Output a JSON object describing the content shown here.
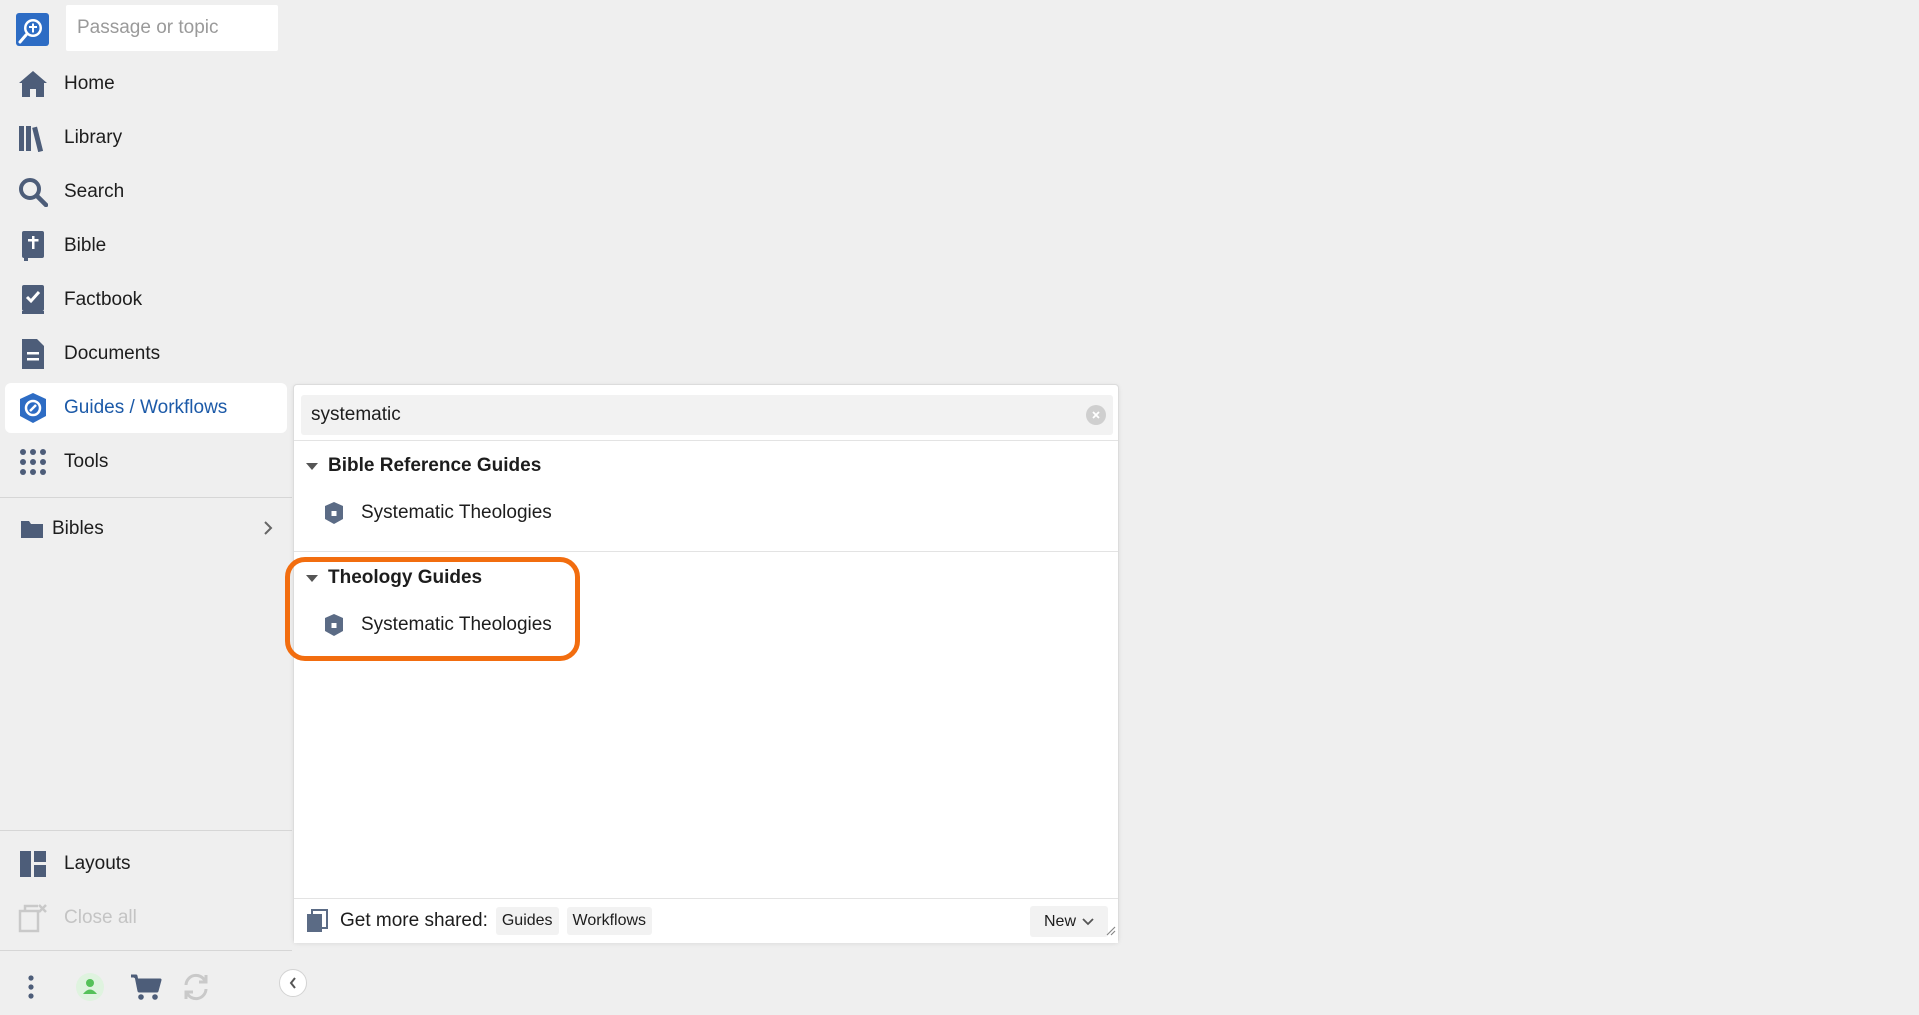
{
  "sidebar": {
    "search": {
      "placeholder": "Passage or topic",
      "value": ""
    },
    "nav": [
      {
        "label": "Home",
        "icon": "home-icon"
      },
      {
        "label": "Library",
        "icon": "library-icon"
      },
      {
        "label": "Search",
        "icon": "search-icon"
      },
      {
        "label": "Bible",
        "icon": "bible-icon"
      },
      {
        "label": "Factbook",
        "icon": "factbook-icon"
      },
      {
        "label": "Documents",
        "icon": "documents-icon"
      },
      {
        "label": "Guides / Workflows",
        "icon": "guides-icon",
        "active": true
      },
      {
        "label": "Tools",
        "icon": "tools-grid-icon"
      }
    ],
    "folders": [
      {
        "label": "Bibles",
        "icon": "folder-icon"
      }
    ],
    "bottom_nav": [
      {
        "label": "Layouts",
        "icon": "layouts-icon"
      },
      {
        "label": "Close all",
        "icon": "close-all-icon",
        "disabled": true
      }
    ]
  },
  "panel": {
    "filter": {
      "value": "systematic"
    },
    "groups": [
      {
        "title": "Bible Reference Guides",
        "items": [
          {
            "label": "Systematic Theologies",
            "icon": "guide-shield-icon"
          }
        ]
      },
      {
        "title": "Theology Guides",
        "items": [
          {
            "label": "Systematic Theologies",
            "icon": "guide-shield-icon"
          }
        ]
      }
    ],
    "footer": {
      "shared_label": "Get more shared:",
      "chips": [
        "Guides",
        "Workflows"
      ],
      "new_label": "New"
    }
  },
  "colors": {
    "accent": "#1c5aa8",
    "icon": "#4d5d79",
    "highlight": "#f26d0f",
    "background": "#efefef",
    "user_status": "#55c159"
  }
}
